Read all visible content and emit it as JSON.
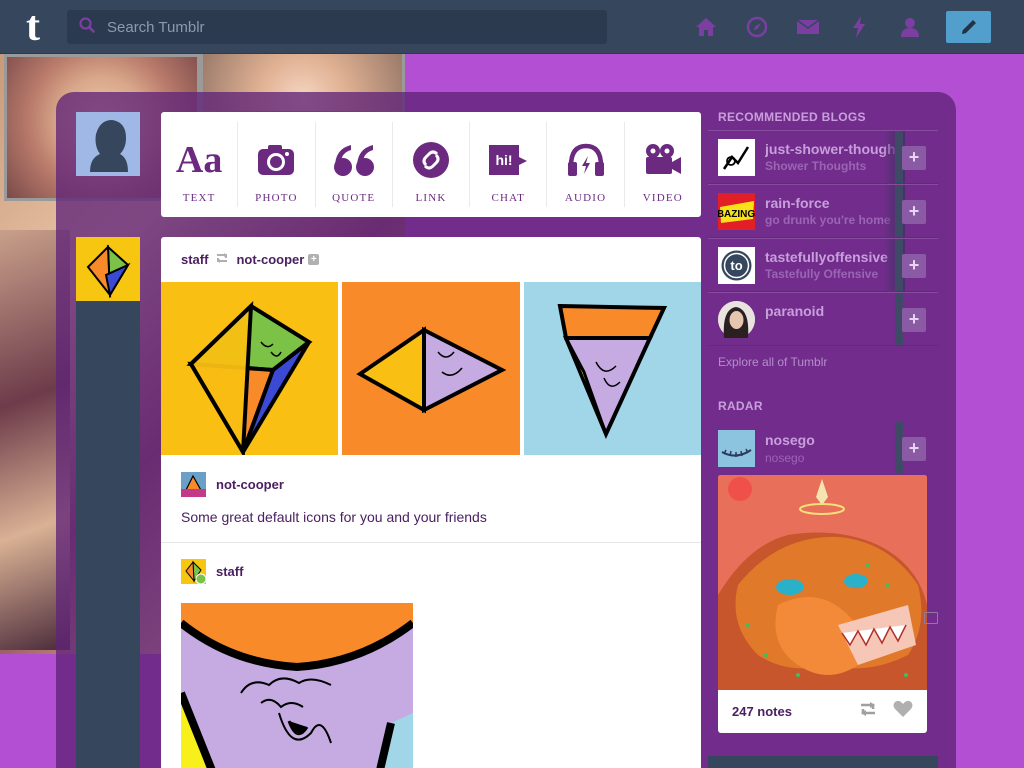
{
  "topbar": {
    "logo": "t",
    "search_placeholder": "Search Tumblr"
  },
  "nav": [
    "home-icon",
    "explore-compass-icon",
    "inbox-mail-icon",
    "activity-lightning-icon",
    "account-person-icon"
  ],
  "post_types": [
    {
      "label": "TEXT",
      "icon": "text-aa-icon"
    },
    {
      "label": "PHOTO",
      "icon": "camera-icon"
    },
    {
      "label": "QUOTE",
      "icon": "quote-icon"
    },
    {
      "label": "LINK",
      "icon": "link-icon"
    },
    {
      "label": "CHAT",
      "icon": "chat-bubble-icon"
    },
    {
      "label": "AUDIO",
      "icon": "headphones-icon"
    },
    {
      "label": "VIDEO",
      "icon": "video-camera-icon"
    }
  ],
  "post": {
    "author": "staff",
    "reblogged_from": "not-cooper",
    "reblog_1": {
      "name": "not-cooper",
      "text": "Some great default icons for you and your friends"
    },
    "reblog_2": {
      "name": "staff"
    }
  },
  "sidebar": {
    "recommended_title": "RECOMMENDED BLOGS",
    "recommended": [
      {
        "name": "just-shower-thoughts",
        "title": "Shower Thoughts",
        "avatar_color": "#ffffff"
      },
      {
        "name": "rain-force",
        "title": "go drunk you're home",
        "avatar_color": "#e21e26"
      },
      {
        "name": "tastefullyoffensive",
        "title": "Tastefully Offensive",
        "avatar_color": "#ffffff"
      },
      {
        "name": "paranoid",
        "title": "",
        "avatar_color": "#d6c9c0"
      }
    ],
    "explore": "Explore all of Tumblr",
    "radar_title": "RADAR",
    "radar": {
      "name": "nosego",
      "title": "nosego",
      "notes": "247 notes"
    }
  },
  "colors": {
    "topbar": "#36465d",
    "accent_purple": "#6b2a80",
    "compose": "#529ecc"
  }
}
